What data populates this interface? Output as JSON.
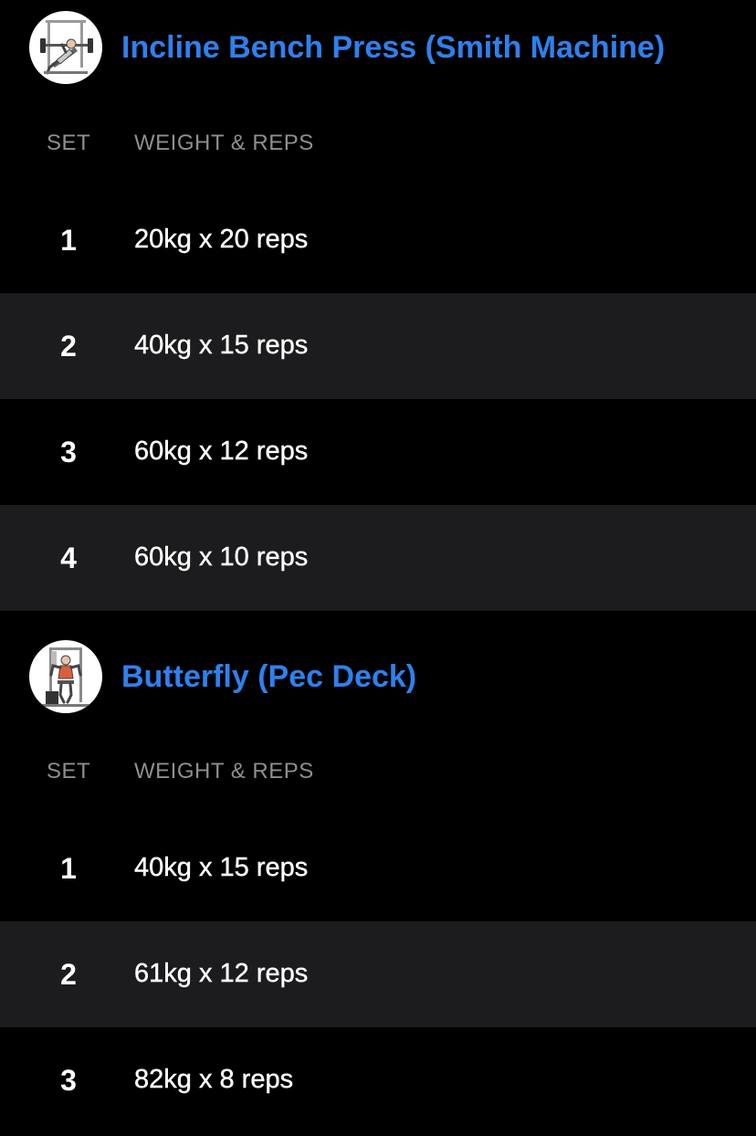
{
  "colors": {
    "background": "#000000",
    "row_alt": "#1c1c1e",
    "accent": "#2f80ed",
    "header_text": "#8e8e93",
    "text": "#ffffff"
  },
  "exercises": [
    {
      "title": "Incline Bench Press (Smith Machine)",
      "thumbnail_icon": "incline-bench-press-illustration",
      "col_set": "SET",
      "col_weight_reps": "WEIGHT & REPS",
      "sets": [
        {
          "num": "1",
          "value": "20kg x 20 reps"
        },
        {
          "num": "2",
          "value": "40kg x 15 reps"
        },
        {
          "num": "3",
          "value": "60kg x 12 reps"
        },
        {
          "num": "4",
          "value": "60kg x 10 reps"
        }
      ]
    },
    {
      "title": "Butterfly (Pec Deck)",
      "thumbnail_icon": "pec-deck-illustration",
      "col_set": "SET",
      "col_weight_reps": "WEIGHT & REPS",
      "sets": [
        {
          "num": "1",
          "value": "40kg x 15 reps"
        },
        {
          "num": "2",
          "value": "61kg x 12 reps"
        },
        {
          "num": "3",
          "value": "82kg x 8 reps"
        }
      ]
    }
  ]
}
